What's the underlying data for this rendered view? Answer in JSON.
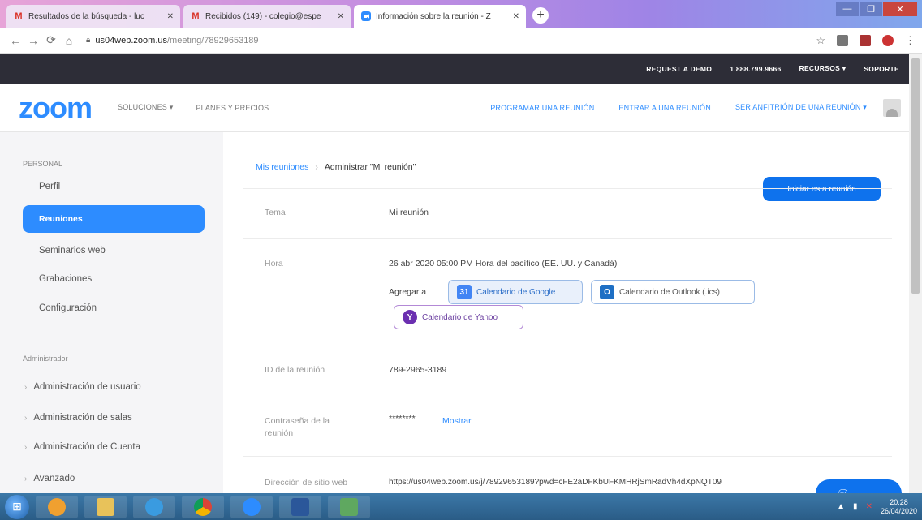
{
  "browser": {
    "tabs": [
      {
        "favicon": "M",
        "title": "Resultados de la búsqueda - luc"
      },
      {
        "favicon": "M",
        "title": "Recibidos (149) - colegio@espe"
      },
      {
        "favicon": "zoom-icon",
        "title": "Información sobre la reunión - Z"
      }
    ],
    "new_tab": "+",
    "url_host": "us04web.zoom.us",
    "url_path": "/meeting/78929653189"
  },
  "topbar": {
    "request_demo": "REQUEST A DEMO",
    "phone": "1.888.799.9666",
    "resources": "RECURSOS ▾",
    "support": "SOPORTE"
  },
  "nav": {
    "logo": "zoom",
    "solutions": "SOLUCIONES ▾",
    "plans": "PLANES Y PRECIOS",
    "schedule": "PROGRAMAR UNA REUNIÓN",
    "join": "ENTRAR A UNA REUNIÓN",
    "host": "SER ANFITRIÓN DE UNA REUNIÓN ▾"
  },
  "sidebar": {
    "personal_title": "PERSONAL",
    "items": [
      {
        "label": "Perfil"
      },
      {
        "label": "Reuniones"
      },
      {
        "label": "Seminarios web"
      },
      {
        "label": "Grabaciones"
      },
      {
        "label": "Configuración"
      }
    ],
    "admin_title": "Administrador",
    "admin_items": [
      {
        "label": "Administración de usuario"
      },
      {
        "label": "Administración de salas"
      },
      {
        "label": "Administración de Cuenta"
      },
      {
        "label": "Avanzado"
      }
    ]
  },
  "main": {
    "breadcrumb_link": "Mis reuniones",
    "breadcrumb_sep": "›",
    "breadcrumb_current": "Administrar \"Mi reunión\"",
    "start_button": "Iniciar esta reunión",
    "topic_label": "Tema",
    "topic_value": "Mi reunión",
    "time_label": "Hora",
    "time_value": "26 abr 2020 05:00 PM Hora del pacífico (EE. UU. y Canadá)",
    "add_to": "Agregar a",
    "google_cal": "Calendario de Google",
    "outlook_cal": "Calendario de Outlook (.ics)",
    "yahoo_cal": "Calendario de Yahoo",
    "meeting_id_label": "ID de la reunión",
    "meeting_id_value": "789-2965-3189",
    "password_label": "Contraseña de la reunión",
    "password_value": "********",
    "show_password": "Mostrar",
    "url_label": "Dirección de sitio web",
    "url_value": "https://us04web.zoom.us/j/78929653189?pwd=cFE2aDFKbUFKMHRjSmRadVh4dXpNQT09"
  },
  "taskbar": {
    "clock_time": "20:28",
    "clock_date": "26/04/2020"
  }
}
